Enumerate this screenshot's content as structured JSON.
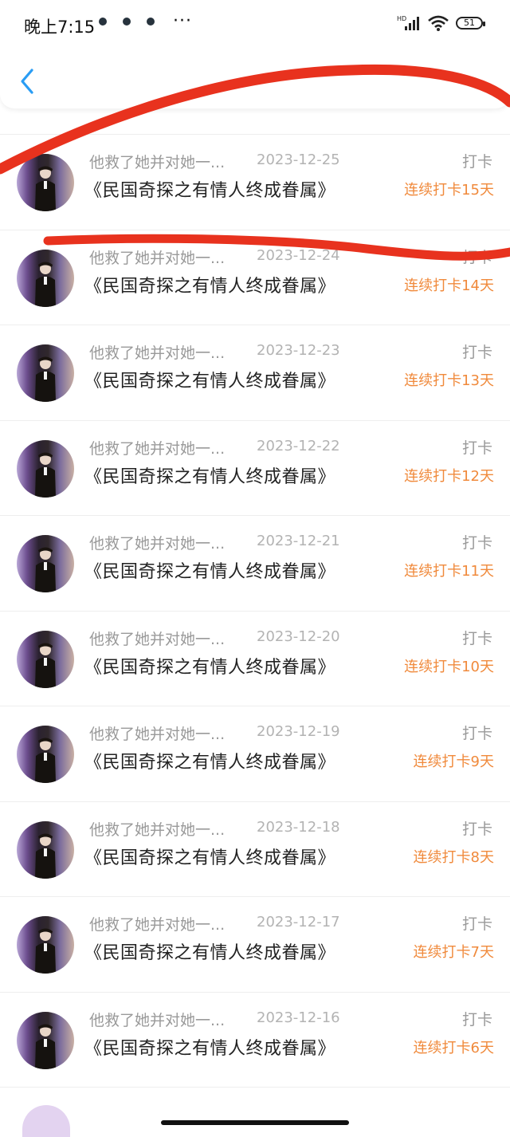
{
  "status_bar": {
    "time": "晚上7:15",
    "more": "···",
    "network": "HD",
    "battery": "51"
  },
  "entries": [
    {
      "snippet": "他救了她并对她一...",
      "date": "2023-12-25",
      "title": "《民国奇探之有情人终成眷属》",
      "action": "打卡",
      "streak": "连续打卡15天"
    },
    {
      "snippet": "他救了她并对她一...",
      "date": "2023-12-24",
      "title": "《民国奇探之有情人终成眷属》",
      "action": "打卡",
      "streak": "连续打卡14天"
    },
    {
      "snippet": "他救了她并对她一...",
      "date": "2023-12-23",
      "title": "《民国奇探之有情人终成眷属》",
      "action": "打卡",
      "streak": "连续打卡13天"
    },
    {
      "snippet": "他救了她并对她一...",
      "date": "2023-12-22",
      "title": "《民国奇探之有情人终成眷属》",
      "action": "打卡",
      "streak": "连续打卡12天"
    },
    {
      "snippet": "他救了她并对她一...",
      "date": "2023-12-21",
      "title": "《民国奇探之有情人终成眷属》",
      "action": "打卡",
      "streak": "连续打卡11天"
    },
    {
      "snippet": "他救了她并对她一...",
      "date": "2023-12-20",
      "title": "《民国奇探之有情人终成眷属》",
      "action": "打卡",
      "streak": "连续打卡10天"
    },
    {
      "snippet": "他救了她并对她一...",
      "date": "2023-12-19",
      "title": "《民国奇探之有情人终成眷属》",
      "action": "打卡",
      "streak": "连续打卡9天"
    },
    {
      "snippet": "他救了她并对她一...",
      "date": "2023-12-18",
      "title": "《民国奇探之有情人终成眷属》",
      "action": "打卡",
      "streak": "连续打卡8天"
    },
    {
      "snippet": "他救了她并对她一...",
      "date": "2023-12-17",
      "title": "《民国奇探之有情人终成眷属》",
      "action": "打卡",
      "streak": "连续打卡7天"
    },
    {
      "snippet": "他救了她并对她一...",
      "date": "2023-12-16",
      "title": "《民国奇探之有情人终成眷属》",
      "action": "打卡",
      "streak": "连续打卡6天"
    }
  ],
  "colors": {
    "accent": "#f08a3c",
    "back_icon": "#2a9df4",
    "annotation": "#e8321e"
  }
}
